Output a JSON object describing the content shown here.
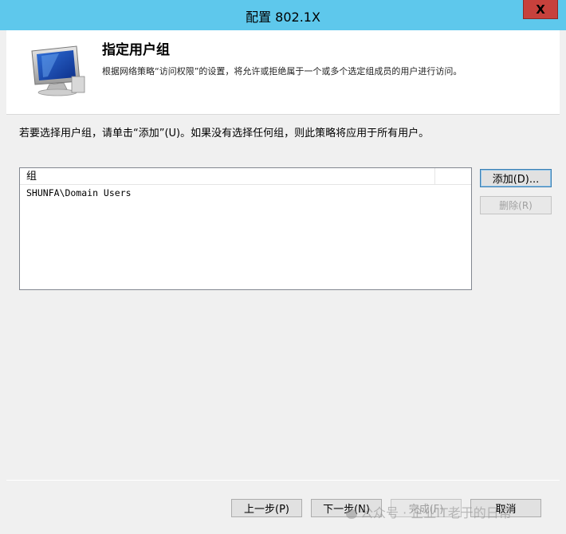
{
  "window": {
    "title": "配置 802.1X",
    "close_label": "X"
  },
  "banner": {
    "title": "指定用户组",
    "description": "根据网络策略“访问权限”的设置，将允许或拒绝属于一个或多个选定组成员的用户进行访问。",
    "icon": "computer-monitor-icon"
  },
  "instruction": "若要选择用户组，请单击“添加”(U)。如果没有选择任何组，则此策略将应用于所有用户。",
  "group_list": {
    "column_header": "组",
    "rows": [
      "SHUNFA\\Domain Users"
    ]
  },
  "buttons": {
    "add": "添加(D)...",
    "remove": "删除(R)",
    "back": "上一步(P)",
    "next": "下一步(N)",
    "finish": "完成(F)",
    "cancel": "取消"
  },
  "watermark": "公众号 · 企业IT老于的日常",
  "colors": {
    "titlebar": "#5ec8ec",
    "close": "#c7413c",
    "background": "#f0f0f0"
  }
}
